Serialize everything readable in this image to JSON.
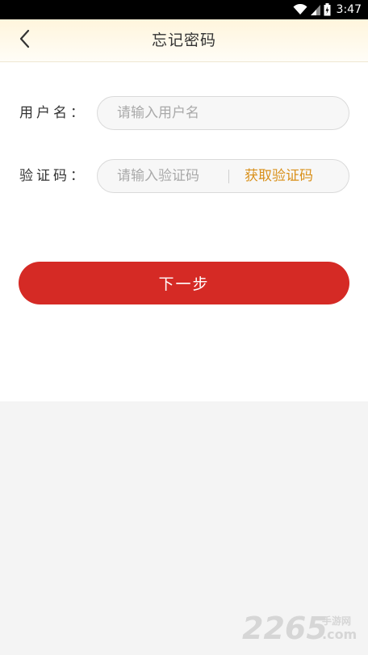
{
  "status_bar": {
    "time": "3:47",
    "icons": [
      "wifi-icon",
      "signal-icon",
      "battery-icon"
    ]
  },
  "header": {
    "back_icon": "chevron-left-icon",
    "title": "忘记密码"
  },
  "form": {
    "username": {
      "label": "用户名：",
      "placeholder": "请输入用户名",
      "value": ""
    },
    "code": {
      "label": "验证码：",
      "placeholder": "请输入验证码",
      "value": "",
      "get_code_label": "获取验证码"
    }
  },
  "next_button": {
    "label": "下一步"
  },
  "watermark": {
    "number": "2265",
    "com": ".com",
    "cn": "手游网"
  },
  "colors": {
    "primary_button": "#d52a25",
    "link_orange": "#d9901a",
    "header_bg": "#fff5dc",
    "page_bg": "#f4f4f4"
  }
}
